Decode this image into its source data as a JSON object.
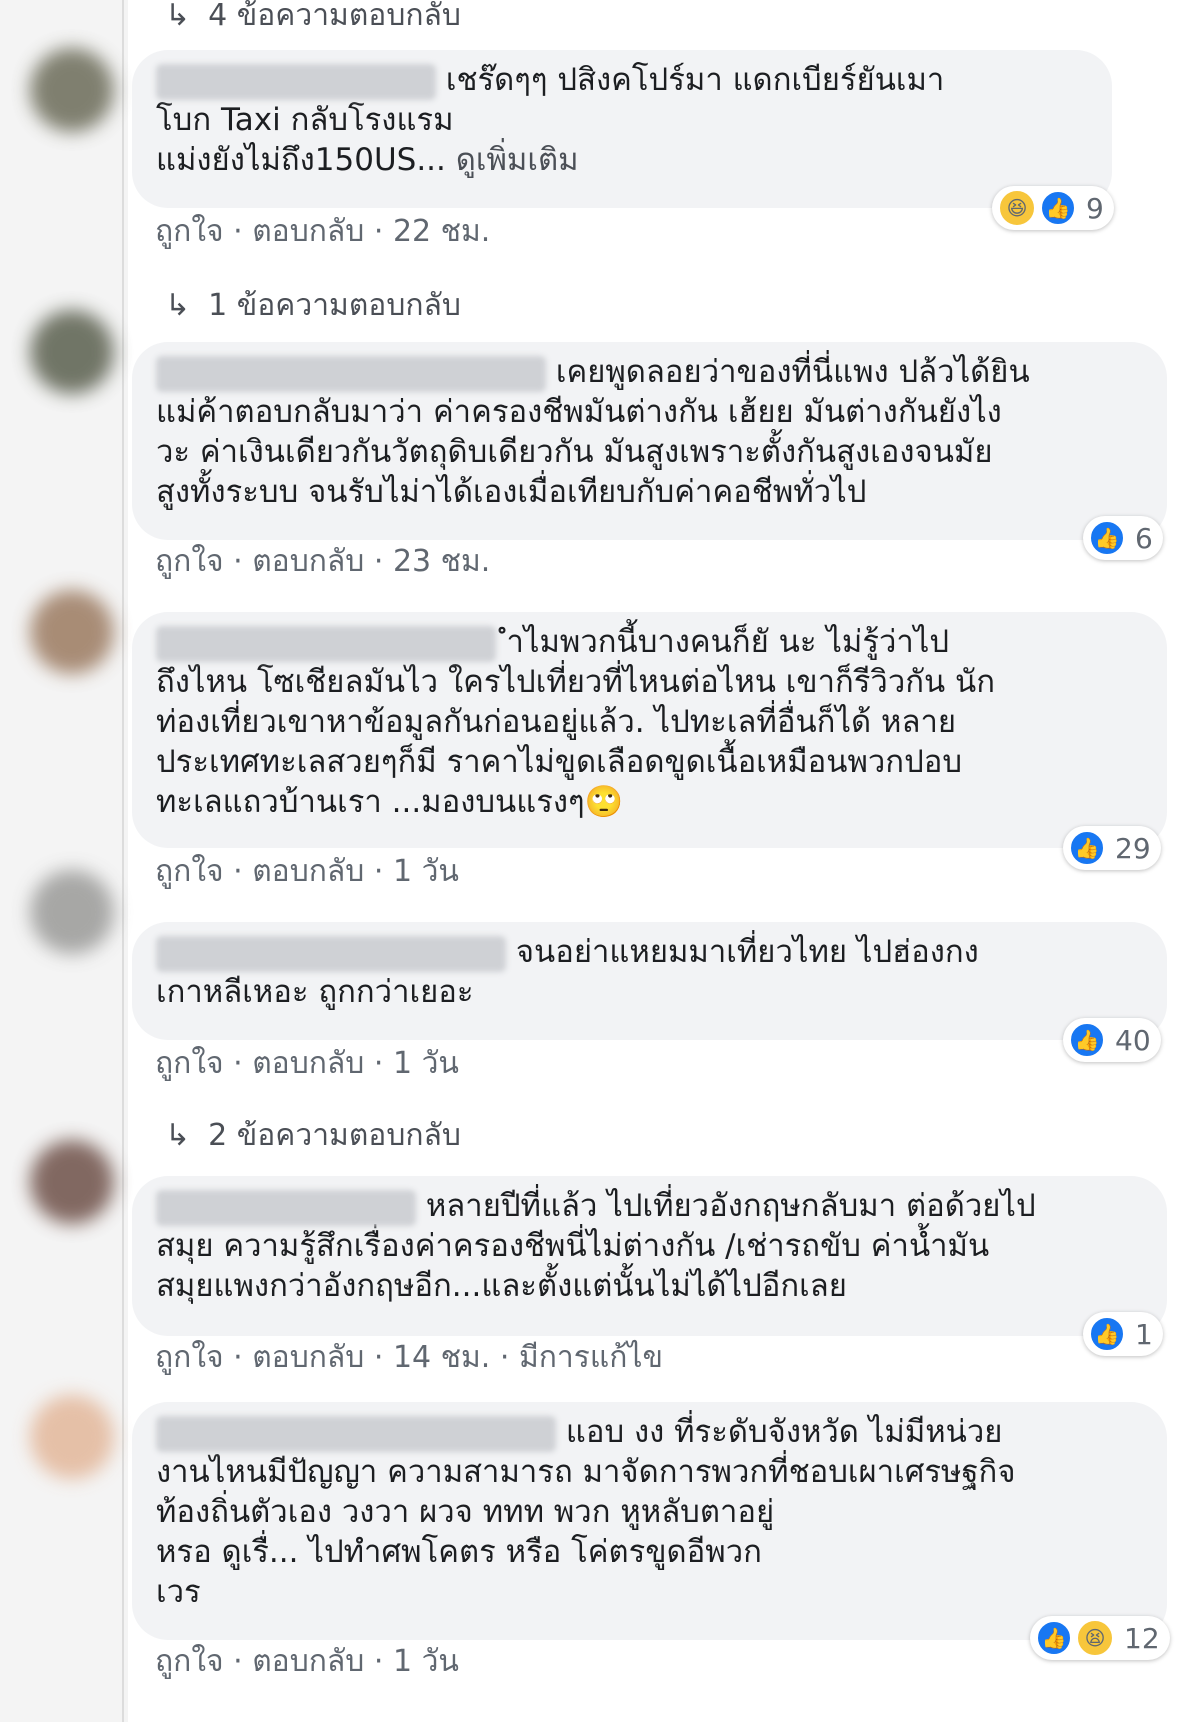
{
  "top_replies": {
    "label": "4 ข้อความตอบกลับ"
  },
  "comments": [
    {
      "lines": [
        "เชร๊ดๆๆ ปสิงคโปร์มา แดกเบียร์ยันเมา",
        "โบก Taxi กลับโรงแรม",
        "แม่งยังไม่ถึง150US..."
      ],
      "see_more": "ดูเพิ่มเติม",
      "like": "ถูกใจ",
      "reply": "ตอบกลับ",
      "time": "22 ชม.",
      "reaction_count": "9",
      "replies_label": "1 ข้อความตอบกลับ"
    },
    {
      "lines": [
        "เคยพูดลอยว่าของที่นี่แพง ปล้วได้ยิน",
        "แม่ค้าตอบกลับมาว่า ค่าครองชีพมันต่างกัน เฮ้ยย มันต่างกันยังไง",
        "วะ ค่าเงินเดียวกันวัตถุดิบเดียวกัน มันสูงเพราะตั้งกันสูงเองจนมัย",
        "สูงทั้งระบบ จนรับไม่าได้เองเมื่อเทียบกับค่าคอชีพทั่วไป"
      ],
      "like": "ถูกใจ",
      "reply": "ตอบกลับ",
      "time": "23 ชม.",
      "reaction_count": "6"
    },
    {
      "lines": [
        "ำไมพวกนี้บางคนก็ยั นะ ไม่รู้ว่าไป",
        "ถึงไหน โซเชียลมันไว ใครไปเที่ยวที่ไหนต่อไหน เขาก็รีวิวกัน นัก",
        "ท่องเที่ยวเขาหาข้อมูลกันก่อนอยู่แล้ว. ไปทะเลที่อื่นก็ได้ หลาย",
        "ประเทศทะเลสวยๆก็มี ราคาไม่ขูดเลือดขูดเนื้อเหมือนพวกปอบ",
        "ทะเลแถวบ้านเรา ...มองบนแรงๆ🙄"
      ],
      "like": "ถูกใจ",
      "reply": "ตอบกลับ",
      "time": "1 วัน",
      "reaction_count": "29"
    },
    {
      "lines": [
        "จนอย่าแหยมมาเที่ยวไทย ไปฮ่องกง",
        "เกาหลีเหอะ ถูกกว่าเยอะ"
      ],
      "like": "ถูกใจ",
      "reply": "ตอบกลับ",
      "time": "1 วัน",
      "reaction_count": "40",
      "replies_label": "2 ข้อความตอบกลับ"
    },
    {
      "lines": [
        "หลายปีที่แล้ว ไปเที่ยวอังกฤษกลับมา ต่อด้วยไป",
        "สมุย ความรู้สึกเรื่องค่าครองชีพนี่ไม่ต่างกัน /เช่ารถขับ ค่าน้ำมัน",
        "สมุยแพงกว่าอังกฤษอีก...และตั้งแต่นั้นไม่ได้ไปอีกเลย"
      ],
      "like": "ถูกใจ",
      "reply": "ตอบกลับ",
      "time": "14 ชม.",
      "edited": "มีการแก้ไข",
      "reaction_count": "1"
    },
    {
      "lines": [
        "แอบ งง ที่ระดับจังหวัด ไม่มีหน่วย",
        "งานไหนมีปัญญา ความสามารถ มาจัดการพวกที่ชอบเผาเศรษฐกิจ",
        "ท้องถิ่นตัวเอง วงวา ผวจ ททท พวก หูหลับตาอยู่",
        "หรอ ดูเรื่... ไปทำศพโคตร หรือ โค่ตรขูดอีพวก",
        "เวร"
      ],
      "like": "ถูกใจ",
      "reply": "ตอบกลับ",
      "time": "1 วัน",
      "reaction_count": "12"
    }
  ],
  "colors": {
    "bubble": "#f2f3f5",
    "like_blue": "#1877f2",
    "meta": "#606770"
  }
}
